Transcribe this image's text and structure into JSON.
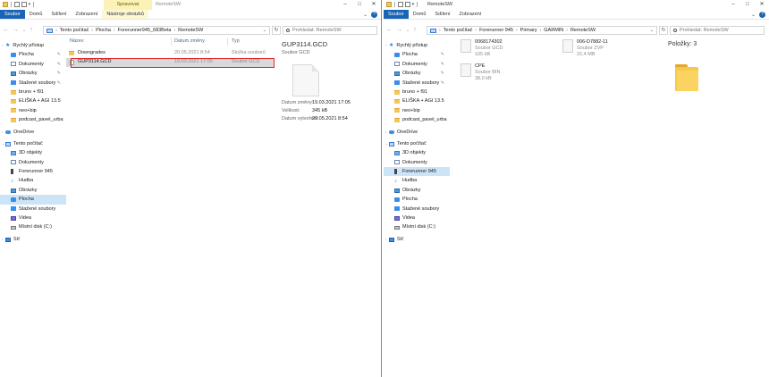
{
  "left": {
    "title_bar": {
      "context_tab": "Spravovat",
      "window_title": "RemoteSW"
    },
    "ribbon_tabs": [
      "Soubor",
      "Domů",
      "Sdílení",
      "Zobrazení",
      "Nástroje obrázků"
    ],
    "address_crumbs": [
      "Tento počítač",
      "Plocha",
      "Forerunner945_683Beta",
      "RemoteSW"
    ],
    "search_placeholder": "Prohledat: RemoteSW",
    "nav_items": [
      {
        "label": "Rychlý přístup",
        "icon": "star-icon"
      },
      {
        "label": "Plocha",
        "icon": "desktop-icon"
      },
      {
        "label": "Dokumenty",
        "icon": "documents-icon"
      },
      {
        "label": "Obrázky",
        "icon": "pictures-icon"
      },
      {
        "label": "Stažené soubory",
        "icon": "downloads-icon"
      },
      {
        "label": "bruno + f91",
        "icon": "folder-icon"
      },
      {
        "label": "ELIŠKA + AGI 13.5",
        "icon": "folder-icon"
      },
      {
        "label": "neo+bip",
        "icon": "folder-icon"
      },
      {
        "label": "podcast_pavel_urba",
        "icon": "folder-icon"
      },
      {
        "label": "OneDrive",
        "icon": "onedrive-icon"
      },
      {
        "label": "Tento počítač",
        "icon": "this-pc-icon"
      },
      {
        "label": "3D objekty",
        "icon": "3d-objects-icon"
      },
      {
        "label": "Dokumenty",
        "icon": "documents-icon"
      },
      {
        "label": "Forerunner 945",
        "icon": "device-icon"
      },
      {
        "label": "Hudba",
        "icon": "music-icon"
      },
      {
        "label": "Obrázky",
        "icon": "pictures-icon"
      },
      {
        "label": "Plocha",
        "icon": "desktop-icon"
      },
      {
        "label": "Stažené soubory",
        "icon": "downloads-icon"
      },
      {
        "label": "Videa",
        "icon": "videos-icon"
      },
      {
        "label": "Místní disk (C:)",
        "icon": "local-disk-icon"
      },
      {
        "label": "Síť",
        "icon": "network-icon"
      }
    ],
    "columns": {
      "name": "Název",
      "date": "Datum změny",
      "type": "Typ"
    },
    "files": [
      {
        "name": "Downgrades",
        "date": "20.05.2021 8:54",
        "type": "Složka souborů"
      },
      {
        "name": "GUP3114.GCD",
        "date": "19.03.2021 17:05",
        "type": "Soubor GCD"
      }
    ],
    "preview": {
      "title": "GUP3114.GCD",
      "type": "Soubor GCD",
      "props": [
        {
          "label": "Datum změny:",
          "value": "19.03.2021 17:05"
        },
        {
          "label": "Velikost:",
          "value": "345 kB"
        },
        {
          "label": "Datum vytvoření:",
          "value": "20.05.2021 8:54"
        }
      ]
    }
  },
  "right": {
    "ribbon_tabs": [
      "Soubor",
      "Domů",
      "Sdílení",
      "Zobrazení"
    ],
    "address_crumbs": [
      "Tento počítač",
      "Forerunner 945",
      "Primary",
      "GARMIN",
      "RemoteSW"
    ],
    "search_placeholder": "Prohledat: RemoteSW",
    "nav_items": [
      {
        "label": "Rychlý přístup",
        "icon": "star-icon"
      },
      {
        "label": "Plocha",
        "icon": "desktop-icon"
      },
      {
        "label": "Dokumenty",
        "icon": "documents-icon"
      },
      {
        "label": "Obrázky",
        "icon": "pictures-icon"
      },
      {
        "label": "Stažené soubory",
        "icon": "downloads-icon"
      },
      {
        "label": "bruno + f91",
        "icon": "folder-icon"
      },
      {
        "label": "ELIŠKA + AGI 13.5",
        "icon": "folder-icon"
      },
      {
        "label": "neo+bip",
        "icon": "folder-icon"
      },
      {
        "label": "podcast_pavel_urba",
        "icon": "folder-icon"
      },
      {
        "label": "OneDrive",
        "icon": "onedrive-icon"
      },
      {
        "label": "Tento počítač",
        "icon": "this-pc-icon"
      },
      {
        "label": "3D objekty",
        "icon": "3d-objects-icon"
      },
      {
        "label": "Dokumenty",
        "icon": "documents-icon"
      },
      {
        "label": "Forerunner 945",
        "icon": "device-icon"
      },
      {
        "label": "Hudba",
        "icon": "music-icon"
      },
      {
        "label": "Obrázky",
        "icon": "pictures-icon"
      },
      {
        "label": "Plocha",
        "icon": "desktop-icon"
      },
      {
        "label": "Stažené soubory",
        "icon": "downloads-icon"
      },
      {
        "label": "Videa",
        "icon": "videos-icon"
      },
      {
        "label": "Místní disk (C:)",
        "icon": "local-disk-icon"
      },
      {
        "label": "Síť",
        "icon": "network-icon"
      }
    ],
    "tiles": [
      {
        "name": "0068174302",
        "type": "Soubor GCD",
        "size": "105 kB"
      },
      {
        "name": "006-D7882-11",
        "type": "Soubor ZVP",
        "size": "22,4 MB"
      },
      {
        "name": "CPE",
        "type": "Soubor BIN",
        "size": "38,0 kB"
      }
    ],
    "items_label": "Položky: 3"
  },
  "colors": {
    "accent": "#1a64b6",
    "selection": "#cce4f7",
    "highlight_box": "#e0262b",
    "context_tab": "#fcf2b5"
  }
}
